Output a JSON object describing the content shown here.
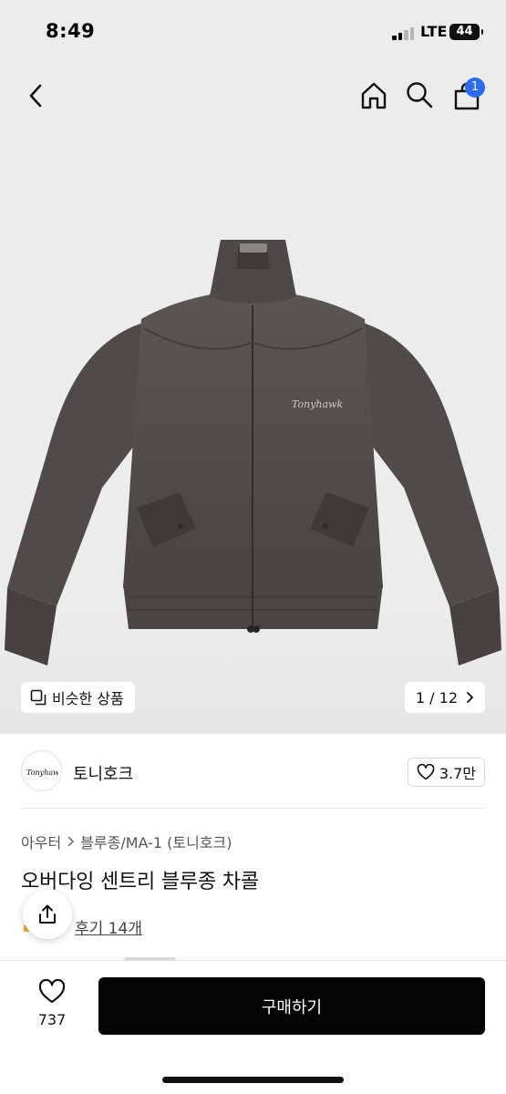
{
  "status_bar": {
    "time": "8:49",
    "network": "LTE",
    "battery": "44"
  },
  "nav": {
    "back_icon": "chevron-left-icon",
    "home_icon": "home-icon",
    "search_icon": "search-icon",
    "cart_icon": "shopping-bag-icon",
    "cart_count": "1",
    "badge_color": "#2f6bf0"
  },
  "gallery": {
    "similar_label": "비슷한 상품",
    "page_indicator": "1 / 12",
    "brand_stitch": "Tonyhawk"
  },
  "shop": {
    "logo_text": "Tonyhawk",
    "name": "토니호크",
    "likes": "3.7만"
  },
  "breadcrumb": {
    "items": [
      "아우터",
      "블루종/MA-1 (토니호크)"
    ]
  },
  "product": {
    "title": "오버다잉 센트리 블루종 차콜",
    "review_link": "후기 14개"
  },
  "bottom_bar": {
    "wish_count": "737",
    "buy_label": "구매하기"
  }
}
